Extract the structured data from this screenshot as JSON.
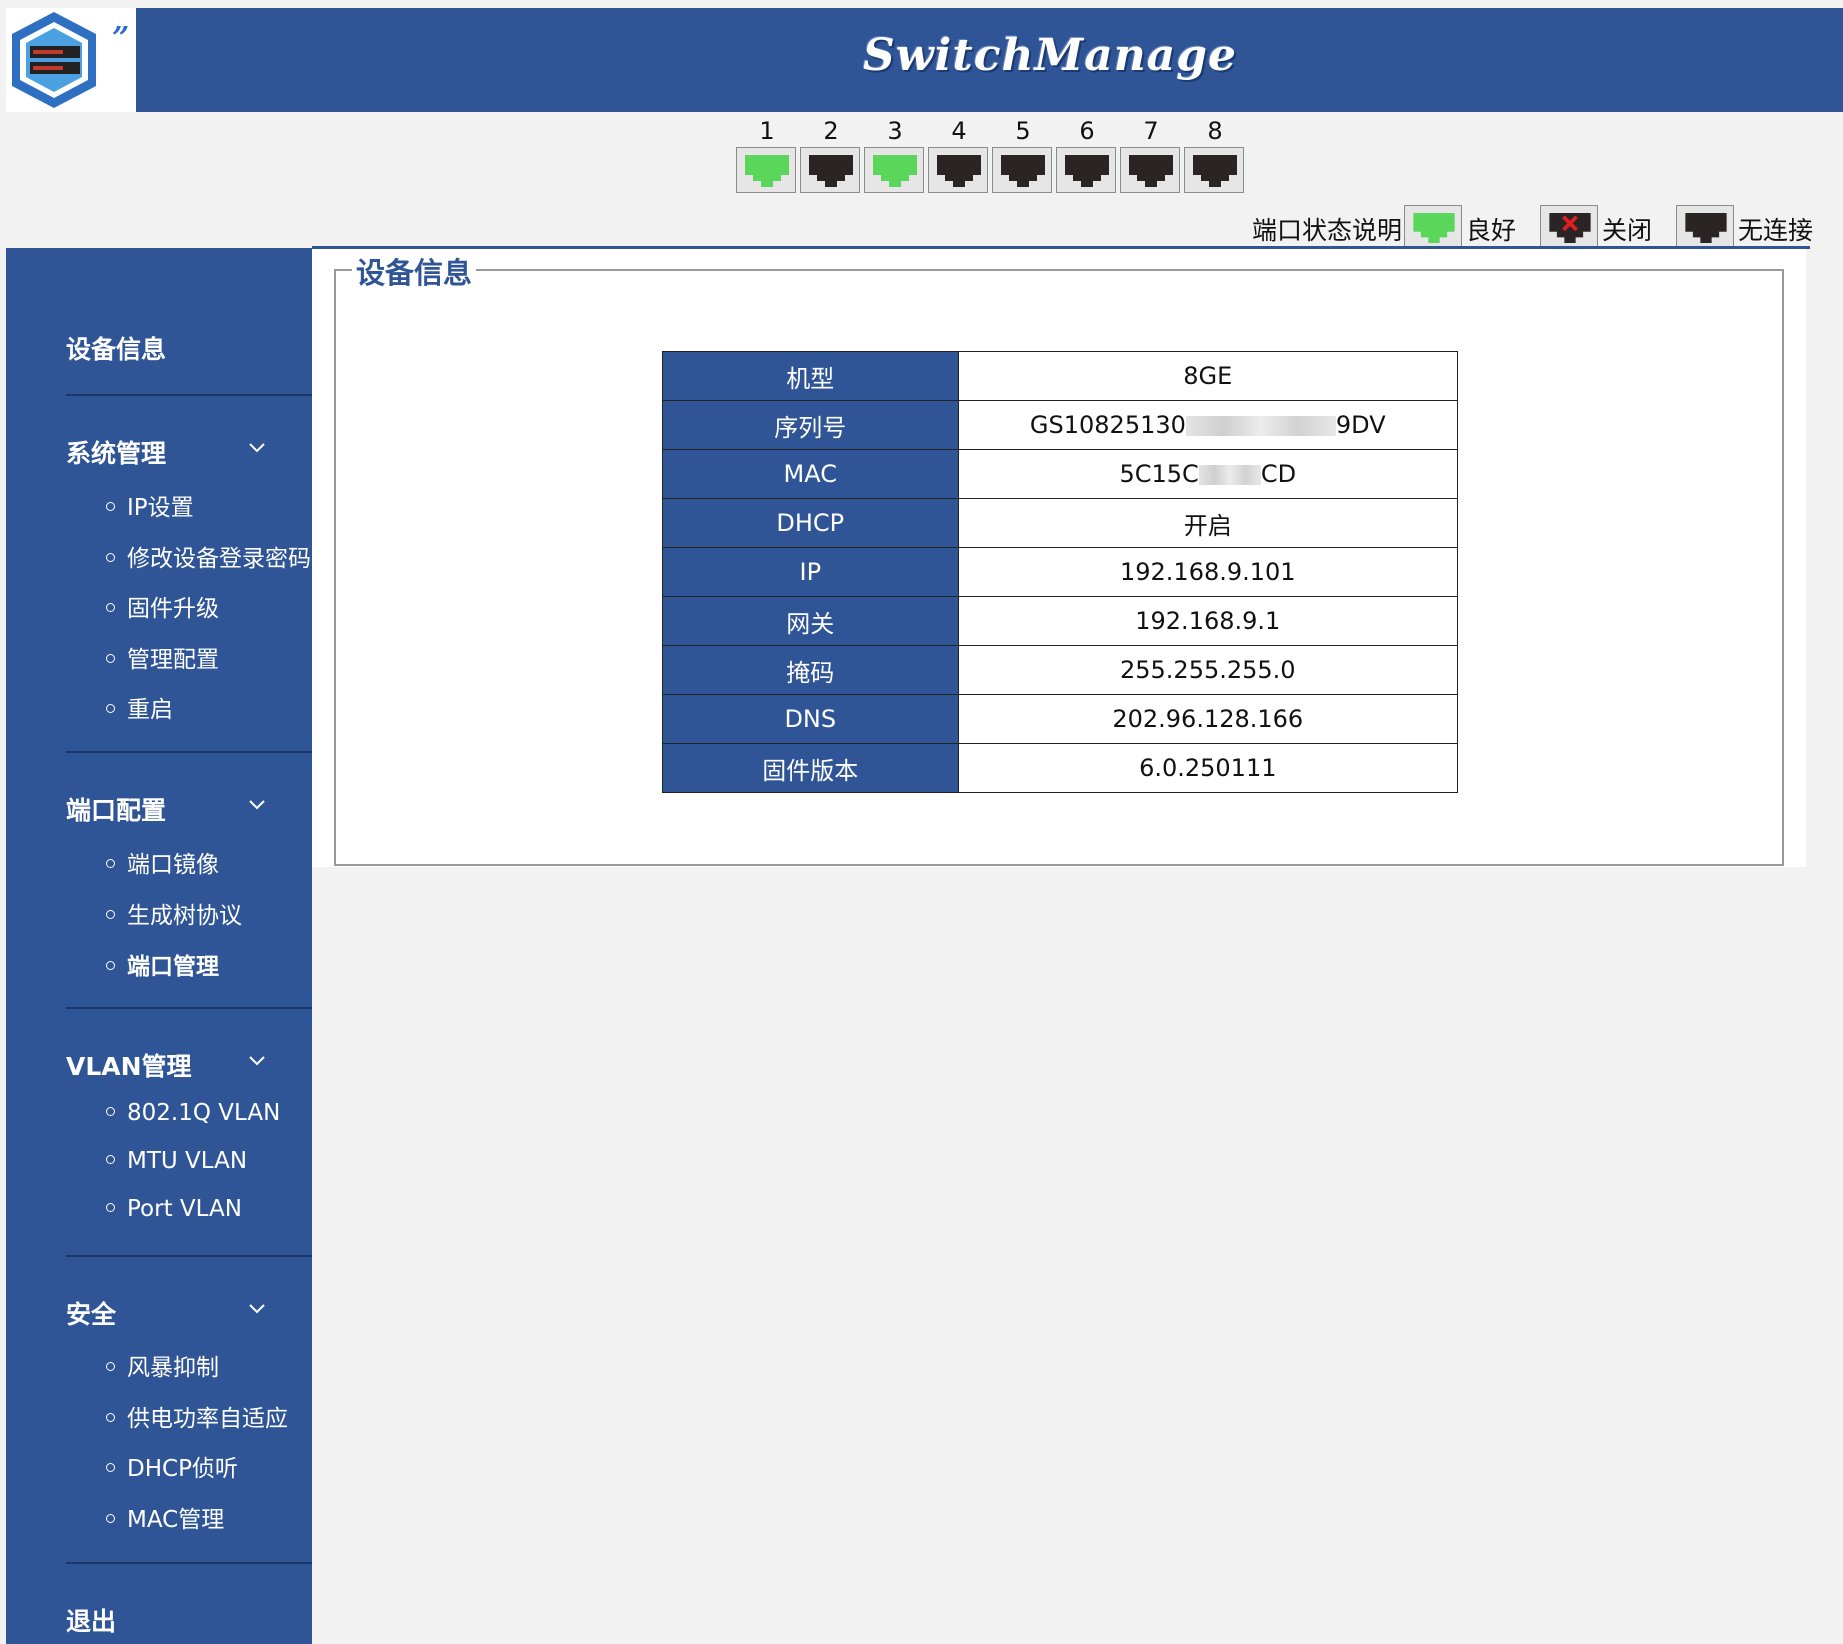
{
  "header": {
    "title": "SwitchManage",
    "colors": {
      "primary": "#2f5597",
      "port_active": "#5ad65a",
      "port_inactive": "#2b2424"
    }
  },
  "ports": [
    {
      "number": "1",
      "status": "good"
    },
    {
      "number": "2",
      "status": "no-link"
    },
    {
      "number": "3",
      "status": "good"
    },
    {
      "number": "4",
      "status": "no-link"
    },
    {
      "number": "5",
      "status": "no-link"
    },
    {
      "number": "6",
      "status": "no-link"
    },
    {
      "number": "7",
      "status": "no-link"
    },
    {
      "number": "8",
      "status": "no-link"
    }
  ],
  "legend": {
    "label": "端口状态说明:",
    "good": "良好",
    "off": "关闭",
    "no_link": "无连接"
  },
  "sidebar": {
    "device_info": "设备信息",
    "system": {
      "label": "系统管理",
      "items": [
        "IP设置",
        "修改设备登录密码",
        "固件升级",
        "管理配置",
        "重启"
      ]
    },
    "port_config": {
      "label": "端口配置",
      "items": [
        "端口镜像",
        "生成树协议",
        "端口管理"
      ]
    },
    "vlan": {
      "label": "VLAN管理",
      "items": [
        "802.1Q VLAN",
        "MTU VLAN",
        "Port VLAN"
      ]
    },
    "security": {
      "label": "安全",
      "items": [
        "风暴抑制",
        "供电功率自适应",
        "DHCP侦听",
        "MAC管理"
      ]
    },
    "logout": "退出"
  },
  "main": {
    "title": "设备信息",
    "rows": [
      {
        "key": "机型",
        "value": "8GE"
      },
      {
        "key": "序列号",
        "value_prefix": "GS10825130",
        "value_suffix": "9DV"
      },
      {
        "key": "MAC",
        "value_prefix": "5C15C",
        "value_suffix": "CD"
      },
      {
        "key": "DHCP",
        "value": "开启"
      },
      {
        "key": "IP",
        "value": "192.168.9.101"
      },
      {
        "key": "网关",
        "value": "192.168.9.1"
      },
      {
        "key": "掩码",
        "value": "255.255.255.0"
      },
      {
        "key": "DNS",
        "value": "202.96.128.166"
      },
      {
        "key": "固件版本",
        "value": "6.0.250111"
      }
    ]
  }
}
